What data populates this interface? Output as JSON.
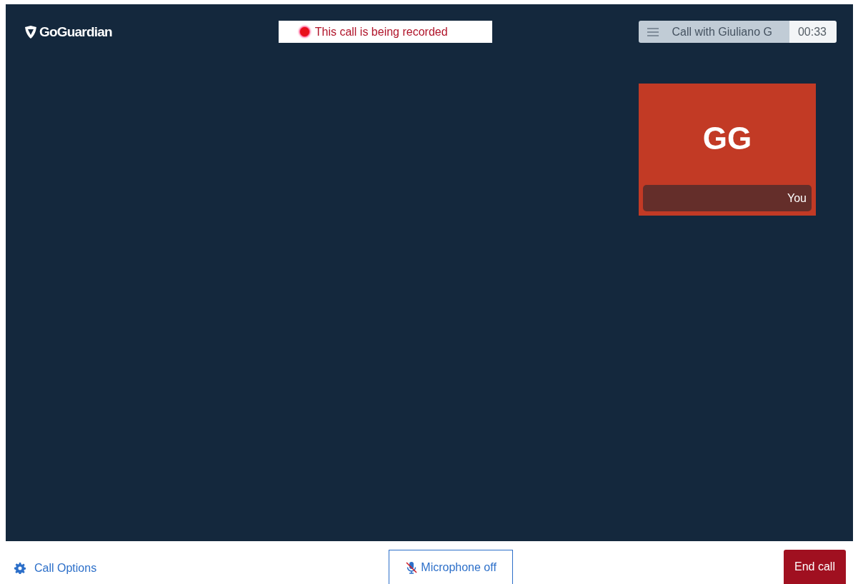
{
  "logo": {
    "text": "GoGuardian"
  },
  "recording_banner": {
    "text": "This call is being recorded",
    "recording": true
  },
  "call_info": {
    "title": "Call with Giuliano G",
    "timer": "00:33"
  },
  "self_tile": {
    "initials": "GG",
    "label": "You",
    "color": "#c23a25"
  },
  "footer": {
    "options_button": "Call Options",
    "microphone_button": {
      "label": "Microphone off",
      "muted": true
    },
    "end_button": "End call"
  }
}
